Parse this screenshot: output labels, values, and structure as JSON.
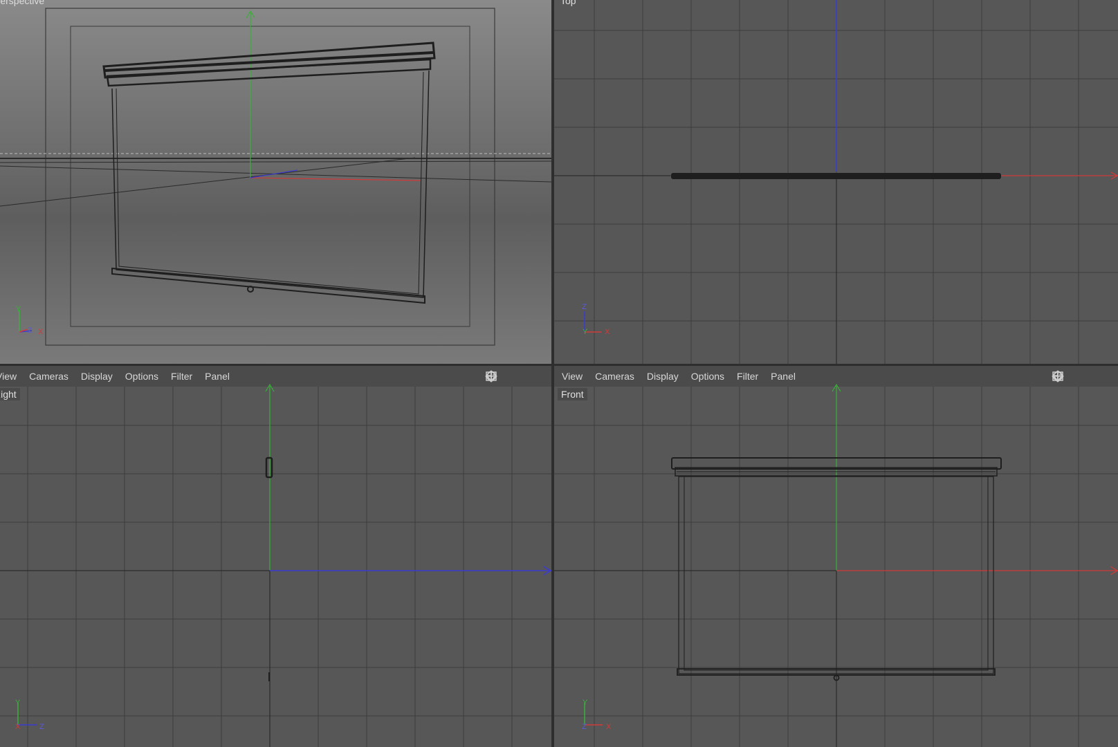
{
  "viewports": {
    "perspective": {
      "label": "Perspective"
    },
    "top": {
      "label": "Top"
    },
    "right": {
      "label": "Right",
      "menu": [
        "View",
        "Cameras",
        "Display",
        "Options",
        "Filter",
        "Panel"
      ]
    },
    "front": {
      "label": "Front",
      "menu": [
        "View",
        "Cameras",
        "Display",
        "Options",
        "Filter",
        "Panel"
      ]
    }
  },
  "axis_gizmo_letters": {
    "x": "X",
    "y": "Y",
    "z": "Z"
  },
  "colors": {
    "x_axis": "#d03a3a",
    "y_axis": "#3ab03a",
    "z_axis": "#3a3ad0",
    "grid": "#3c3c3c",
    "viewport_bg": "#575757"
  },
  "icons": [
    "move-icon",
    "dolly-icon",
    "rotate-icon",
    "maximize-icon"
  ]
}
